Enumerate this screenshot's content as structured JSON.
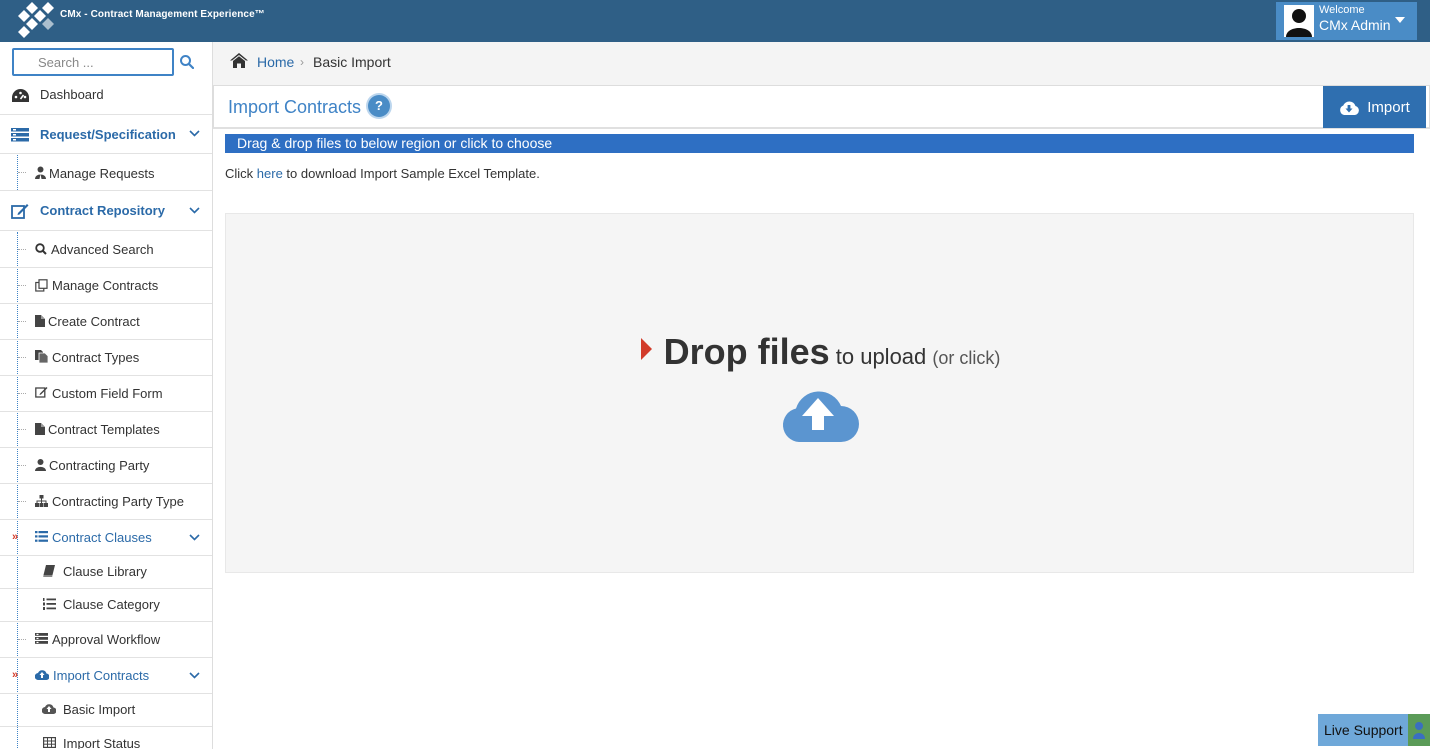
{
  "header": {
    "app_title": "CMx - Contract Management Experience™",
    "welcome": "Welcome",
    "username": "CMx Admin"
  },
  "sidebar": {
    "search_placeholder": "Search ...",
    "items": [
      {
        "label": "Dashboard",
        "icon": "dashboard-icon"
      },
      {
        "label": "Request/Specification",
        "icon": "server-icon"
      },
      {
        "label": "Manage Requests",
        "icon": "user-tie-icon"
      },
      {
        "label": "Contract Repository",
        "icon": "edit-icon"
      },
      {
        "label": "Advanced Search",
        "icon": "search-icon"
      },
      {
        "label": "Manage Contracts",
        "icon": "copy-icon"
      },
      {
        "label": "Create Contract",
        "icon": "file-icon"
      },
      {
        "label": "Contract Types",
        "icon": "files-icon"
      },
      {
        "label": "Custom Field Form",
        "icon": "edit-icon"
      },
      {
        "label": "Contract Templates",
        "icon": "file-icon"
      },
      {
        "label": "Contracting Party",
        "icon": "user-icon"
      },
      {
        "label": "Contracting Party Type",
        "icon": "sitemap-icon"
      },
      {
        "label": "Contract Clauses",
        "icon": "list-icon"
      },
      {
        "label": "Clause Library",
        "icon": "book-icon"
      },
      {
        "label": "Clause Category",
        "icon": "list-ol-icon"
      },
      {
        "label": "Approval Workflow",
        "icon": "server-icon"
      },
      {
        "label": "Import Contracts",
        "icon": "cloud-upload-icon"
      },
      {
        "label": "Basic Import",
        "icon": "cloud-upload-icon"
      },
      {
        "label": "Import Status",
        "icon": "table-icon"
      }
    ]
  },
  "breadcrumb": {
    "home": "Home",
    "separator": "›",
    "current": "Basic Import"
  },
  "page": {
    "title": "Import Contracts",
    "help": "?",
    "import_button": "Import",
    "drag_banner": "Drag & drop files to below region or click to choose",
    "template_prefix": "Click ",
    "template_link": "here",
    "template_suffix": " to download Import Sample Excel Template.",
    "drop_strong": "Drop files",
    "drop_mid": " to upload ",
    "drop_small": "(or click)"
  },
  "support": {
    "label": "Live Support"
  },
  "colors": {
    "topbar": "#2f5f86",
    "accent": "#3f83c6",
    "banner": "#2e6fc3",
    "marker_red": "#d23b2a"
  }
}
